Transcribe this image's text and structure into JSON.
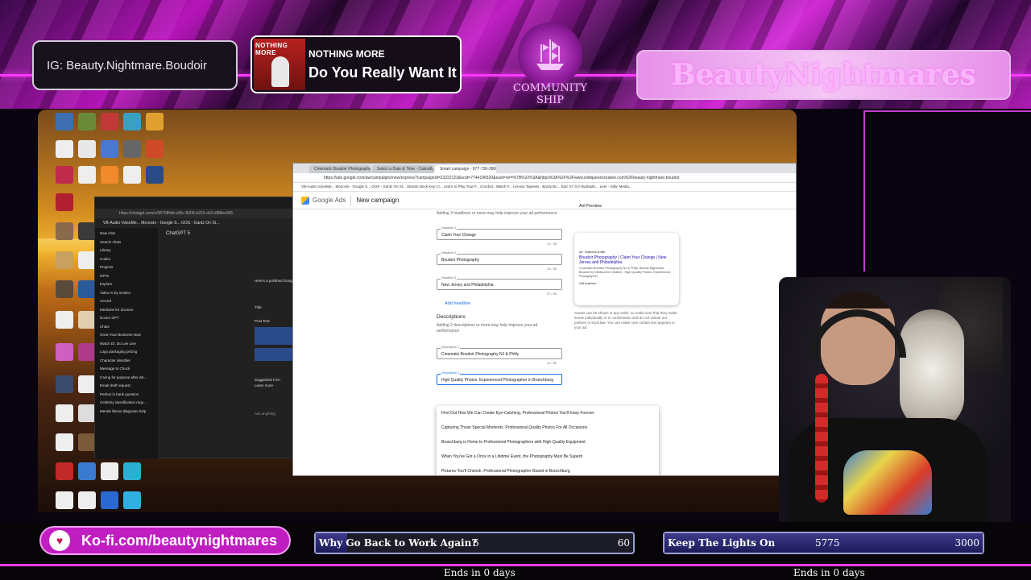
{
  "overlay": {
    "instagram": "IG: Beauty.Nightmare.Boudoir",
    "song_artist": "NOTHING MORE",
    "song_title": "Do You Really Want It",
    "album_tag": "NOTHING MORE",
    "ship_caption": "COMMUNITY SHIP",
    "brand": "BeautyNightmares",
    "kofi": "Ko-fi.com/beautynightmares",
    "goals": [
      {
        "name": "Why Go Back to Work Again?",
        "current": "6",
        "target": "60",
        "progress": 0.1,
        "ends": "Ends in 0 days"
      },
      {
        "name": "Keep The Lights On",
        "current": "5775",
        "target": "3000",
        "progress": 1.0,
        "ends": "Ends in 0 days"
      }
    ]
  },
  "chat_window": {
    "url": "https://chatgpt.com/c/68708fdd-a96c-8005-b253-a52c888be366",
    "bookmarks": "VB-Audio VoiceMe...   Monocle - Google S...   GOS - Gantz On St...",
    "app_label": "ChatGPT 5",
    "sidebar": [
      "New chat",
      "Search chats",
      "Library",
      "Codex",
      "Projects",
      "GPTs",
      "Explore",
      "Video AI by invideo",
      "Accord",
      "Medicine for Doctors",
      "Doctor GPT",
      "Chats",
      "Grow Your Business Now",
      "Watch Dr. Do Lee Live",
      "Logo packaging pricing",
      "Character identifier",
      "Message to Chuck",
      "Caring for purpose after wh...",
      "Email draft request",
      "Perfect in bank question",
      "Celebrity identification requ...",
      "Mental illness diagnosis help"
    ],
    "heading": "Here's a polished Google",
    "title_label": "Title:",
    "post_label": "Post Text:",
    "cta_label": "Suggested CTA:",
    "cta_value": "Learn more",
    "ask": "Ask anything"
  },
  "ads_window": {
    "tabs": [
      "Cinematic Boudoir Photography",
      "Select a Date & Time - Calendly",
      "Smart campaign - 877-736-2800"
    ],
    "url": "https://ads.google.com/aw/campaigns/new/express?campaignId=23222123&ocid=7744196520&euid=ref=%7B%22%3A&https%3A%2F%2Fwww.wildqueencreative.com%2Fbeauty-nightmare-boudoir",
    "bookmarks": "VB-Audio VoiceMe...   Monocle - Google S...   GOS - Gantz On St...   Stream Deck Key Cr...   Learn to Play Your F...   Crocbot - Watch F...   Lenovo   Tapesss - Booty Bo...   Epic X7 3.0 Hydraulic...   Leer - Silla, Media...",
    "logo_text": "Google Ads",
    "page_title": "New campaign",
    "headlines_hint": "Adding 3 headlines or more may help improve your ad performance",
    "headlines": [
      {
        "label": "Headline 1",
        "value": "Claim Your Change",
        "count": "17 / 30"
      },
      {
        "label": "Headline 2",
        "value": "Boudoir Photography",
        "count": "19 / 30"
      },
      {
        "label": "Headline 3",
        "value": "New Jersey and Philadelphia",
        "count": "27 / 30"
      }
    ],
    "add_headline": "Add headline",
    "descriptions_title": "Descriptions",
    "descriptions_hint": "Adding 2 descriptions or more may help improve your ad performance",
    "descriptions": [
      {
        "label": "Description 1",
        "value": "Cinematic Boudoir Photography NJ & Philly",
        "count": "41 / 90"
      },
      {
        "label": "Description 2",
        "value": "High Quality Photos. Experienced Photographer in Branchburg",
        "count": ""
      }
    ],
    "suggestions": [
      "Find Out How We Can Create Eye-Catching, Professional Photos You'll Keep Forever",
      "Capturing Those Special Moments. Professional Quality Photos For All Occasions",
      "Branchburg is Home to Professional Photographers with High-Quality Equipment.",
      "When You've Got a Once in a Lifetime Event, the Photography Must Be Superb",
      "Pictures You'll Cherish. Professional Photographer Based in Branchburg"
    ],
    "preview_title": "Ad Preview",
    "preview_ad_tag": "Ad · Business profile",
    "preview_headline": "Boudoir Photography | Claim Your Change | New Jersey and Philadelphia",
    "preview_desc": "Cinematic Boudoir Photography NJ & Philly. Beauty Nightmare Boudoir by WildQueen Creative - High Quality Photos. Experienced Photographer",
    "preview_call": "Call business",
    "preview_note": "Assets can be shown in any order, so make sure that they make sense individually or in combination and do not violate our policies or local law. You can make sure certain text appears in your ad.",
    "phone": "877-736-2800"
  },
  "colors": {
    "accent": "#ff39ff",
    "kofi": "#c11ec2",
    "google_blue": "#1a73e8"
  }
}
